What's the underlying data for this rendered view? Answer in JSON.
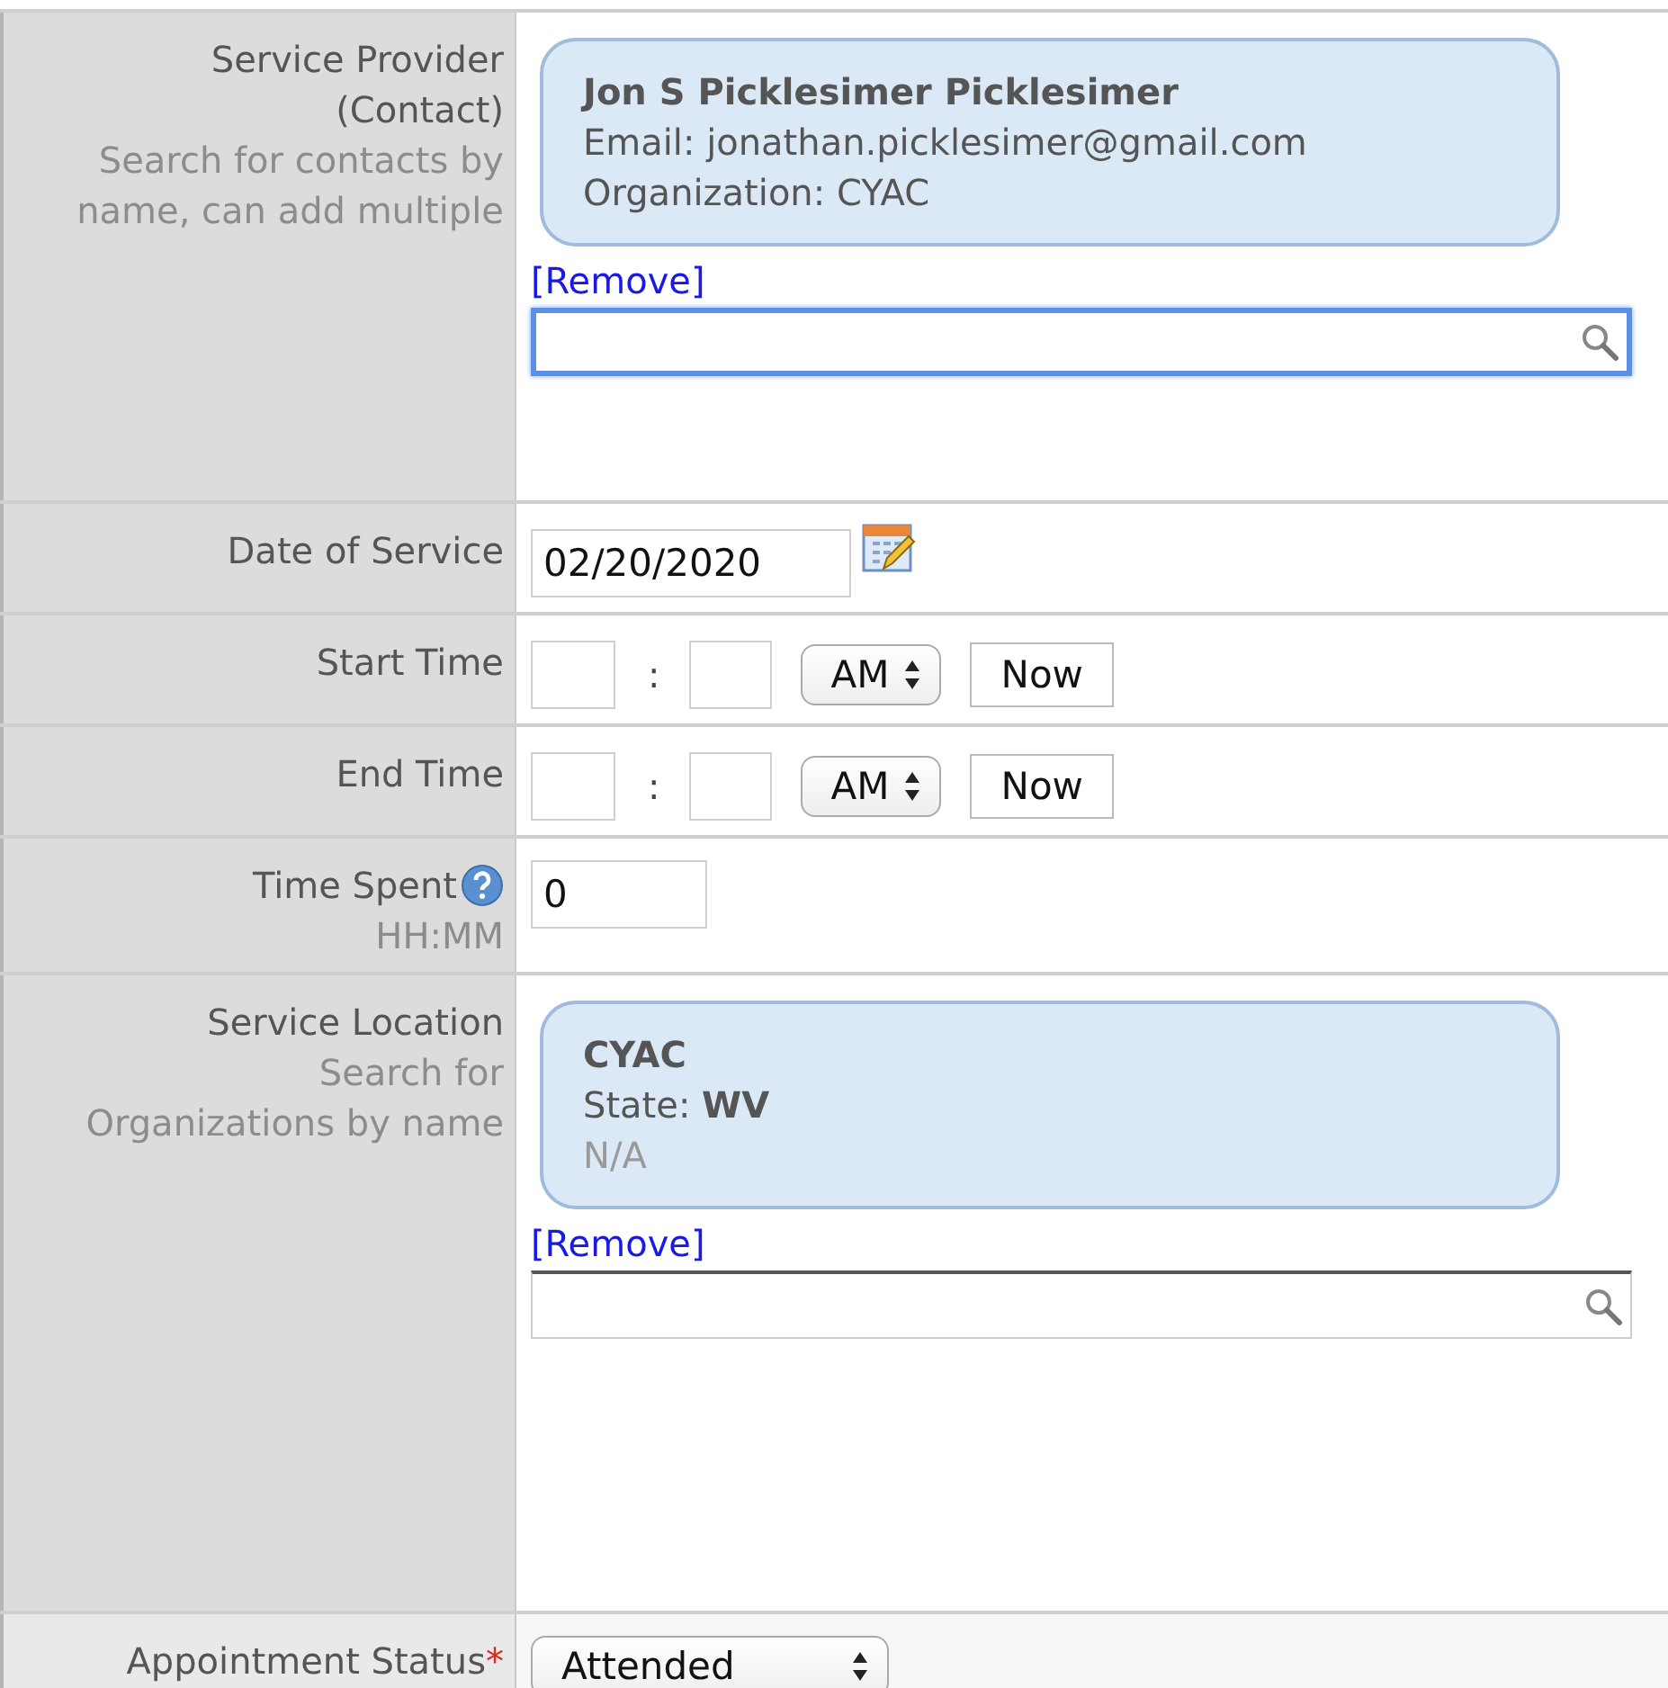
{
  "rows": [
    {
      "kind": "lookup",
      "highlighted": false,
      "label": "Service Provider (Contact)",
      "hint": "Search for contacts by name, can add multiple",
      "card": {
        "title": "Jon S Picklesimer Picklesimer",
        "lines": [
          {
            "text": "Email: jonathan.picklesimer@gmail.com",
            "muted": false
          },
          {
            "text": "Organization: CYAC",
            "muted": false
          }
        ]
      },
      "remove": "[Remove]",
      "search_focused": true
    },
    {
      "kind": "date",
      "highlighted": false,
      "label": "Date of Service",
      "value": "02/20/2020"
    },
    {
      "kind": "time",
      "highlighted": false,
      "label": "Start Time",
      "separator": ":",
      "period": "AM",
      "now": "Now"
    },
    {
      "kind": "time",
      "highlighted": false,
      "label": "End Time",
      "separator": ":",
      "period": "AM",
      "now": "Now"
    },
    {
      "kind": "duration",
      "highlighted": false,
      "label": "Time Spent",
      "hint": "HH:MM",
      "value": "0"
    },
    {
      "kind": "lookup",
      "highlighted": false,
      "label": "Service Location",
      "hint": "Search for Organizations by name",
      "card": {
        "title": "CYAC",
        "lines": [
          {
            "text": "State: **WV**",
            "muted": false
          },
          {
            "text": "N/A",
            "muted": true
          }
        ]
      },
      "remove": "[Remove]",
      "search_focused": false
    },
    {
      "kind": "select",
      "highlighted": true,
      "label": "Appointment Status",
      "required": true,
      "required_mark": "*",
      "value": "Attended"
    }
  ]
}
